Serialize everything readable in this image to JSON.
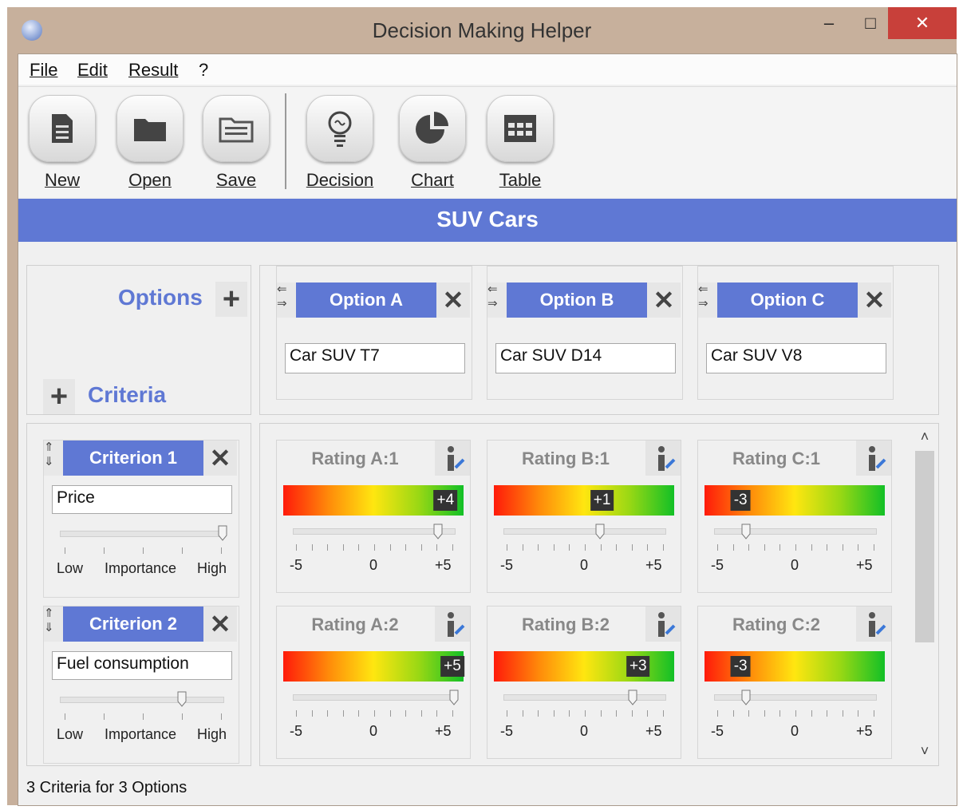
{
  "window": {
    "title": "Decision Making Helper",
    "min_glyph": "‒",
    "max_glyph": "□",
    "close_glyph": "✕"
  },
  "menu": [
    "File",
    "Edit",
    "Result",
    "?"
  ],
  "toolbar": [
    {
      "label": "New",
      "icon": "document-icon"
    },
    {
      "label": "Open",
      "icon": "folder-icon"
    },
    {
      "label": "Save",
      "icon": "save-folder-icon"
    },
    {
      "label": "Decision",
      "icon": "lightbulb-icon"
    },
    {
      "label": "Chart",
      "icon": "pie-chart-icon"
    },
    {
      "label": "Table",
      "icon": "table-icon"
    }
  ],
  "banner": "SUV Cars",
  "options_label": "Options",
  "criteria_label": "Criteria",
  "options": [
    {
      "title": "Option A",
      "value": "Car SUV T7"
    },
    {
      "title": "Option B",
      "value": "Car SUV D14"
    },
    {
      "title": "Option C",
      "value": "Car SUV V8"
    }
  ],
  "criteria": [
    {
      "title": "Criterion 1",
      "value": "Price",
      "importance": 1.0,
      "scale": {
        "low": "Low",
        "mid": "Importance",
        "high": "High"
      },
      "ratings": [
        {
          "title": "Rating A:1",
          "value": 4,
          "display": "+4"
        },
        {
          "title": "Rating B:1",
          "value": 1,
          "display": "+1"
        },
        {
          "title": "Rating C:1",
          "value": -3,
          "display": "-3"
        }
      ]
    },
    {
      "title": "Criterion 2",
      "value": "Fuel consumption",
      "importance": 0.75,
      "scale": {
        "low": "Low",
        "mid": "Importance",
        "high": "High"
      },
      "ratings": [
        {
          "title": "Rating A:2",
          "value": 5,
          "display": "+5"
        },
        {
          "title": "Rating B:2",
          "value": 3,
          "display": "+3"
        },
        {
          "title": "Rating C:2",
          "value": -3,
          "display": "-3"
        }
      ]
    }
  ],
  "rating_scale": {
    "min": "-5",
    "mid": "0",
    "max": "+5"
  },
  "status": "3 Criteria for 3 Options",
  "colors": {
    "accent": "#5f78d4",
    "close": "#c8403a",
    "frame": "#c7b09c"
  }
}
